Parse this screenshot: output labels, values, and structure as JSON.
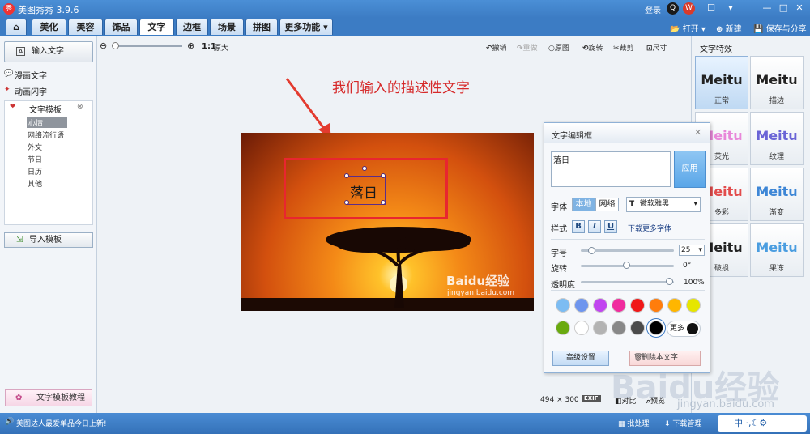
{
  "app": {
    "title": "美图秀秀 3.9.6",
    "login": "登录"
  },
  "tabs": [
    "美化",
    "美容",
    "饰品",
    "文字",
    "边框",
    "场景",
    "拼图",
    "更多功能"
  ],
  "active_tab": "文字",
  "top_right": {
    "open": "打开",
    "new": "新建",
    "save_share": "保存与分享"
  },
  "sidebar": {
    "input_text": "输入文字",
    "comic_text": "漫画文字",
    "animated_text": "动画闪字",
    "templates_title": "文字模板",
    "template_items": [
      "心情",
      "网络流行语",
      "外文",
      "节日",
      "日历",
      "其他"
    ],
    "import_template": "导入模板",
    "tutorial": "文字模板教程"
  },
  "toolbar": {
    "zoom_ratio": "1:1",
    "original_size": "原大",
    "undo": "撤销",
    "redo": "重做",
    "original_image": "原图",
    "rotate": "旋转",
    "crop": "裁剪",
    "size": "尺寸"
  },
  "canvas": {
    "annotation": "我们输入的描述性文字",
    "text_on_image": "落日",
    "watermark_brand": "Baidu经验",
    "watermark_url": "jingyan.baidu.com"
  },
  "dialog": {
    "title": "文字编辑框",
    "text_value": "落日",
    "apply": "应用",
    "font_label": "字体",
    "font_local": "本地",
    "font_network": "网络",
    "font_name": "微软雅黑",
    "style_label": "样式",
    "bold": "B",
    "italic": "I",
    "underline": "U",
    "download_fonts": "下载更多字体",
    "size_label": "字号",
    "size_value": "25",
    "size_level": 0.08,
    "rotate_label": "旋转",
    "rotate_value": "0°",
    "rotate_level": 0.5,
    "opacity_label": "透明度",
    "opacity_value": "100%",
    "opacity_level": 1.0,
    "colors": [
      "#7cbcf2",
      "#6e95ee",
      "#c145f0",
      "#f02c9e",
      "#f01818",
      "#ff7d0c",
      "#ffb600",
      "#e6e600",
      "#6aaa10",
      "#ffffff",
      "#b3b3b3",
      "#888888",
      "#4b4b4b",
      "#000000"
    ],
    "selected_color": "#000000",
    "more_colors": "更多",
    "advanced": "高级设置",
    "delete_text": "删除本文字"
  },
  "effects": {
    "title": "文字特效",
    "items": [
      {
        "sample": "Meitu",
        "label": "正常",
        "color": "#222222"
      },
      {
        "sample": "Meitu",
        "label": "描边",
        "color": "#111111"
      },
      {
        "sample": "Meitu",
        "label": "荧光",
        "color": "#e887d9"
      },
      {
        "sample": "Meitu",
        "label": "纹理",
        "color": "#6a64d6"
      },
      {
        "sample": "Meitu",
        "label": "多彩",
        "color": "#e24c4c"
      },
      {
        "sample": "Meitu",
        "label": "渐变",
        "color": "#3d86d6"
      },
      {
        "sample": "Meitu",
        "label": "破损",
        "color": "#333333"
      },
      {
        "sample": "Meitu",
        "label": "果冻",
        "color": "#4a9de0"
      }
    ]
  },
  "bottom": {
    "width": "494",
    "times": "×",
    "height": "300",
    "exif": "EXIF",
    "compare": "对比",
    "preview": "预览"
  },
  "status": {
    "message": "美图达人最爱单品今日上新!",
    "batch": "批处理",
    "download_manager": "下载管理",
    "ime": "中"
  },
  "page_watermark": {
    "brand": "Baidu经验",
    "url": "jingyan.baidu.com"
  }
}
